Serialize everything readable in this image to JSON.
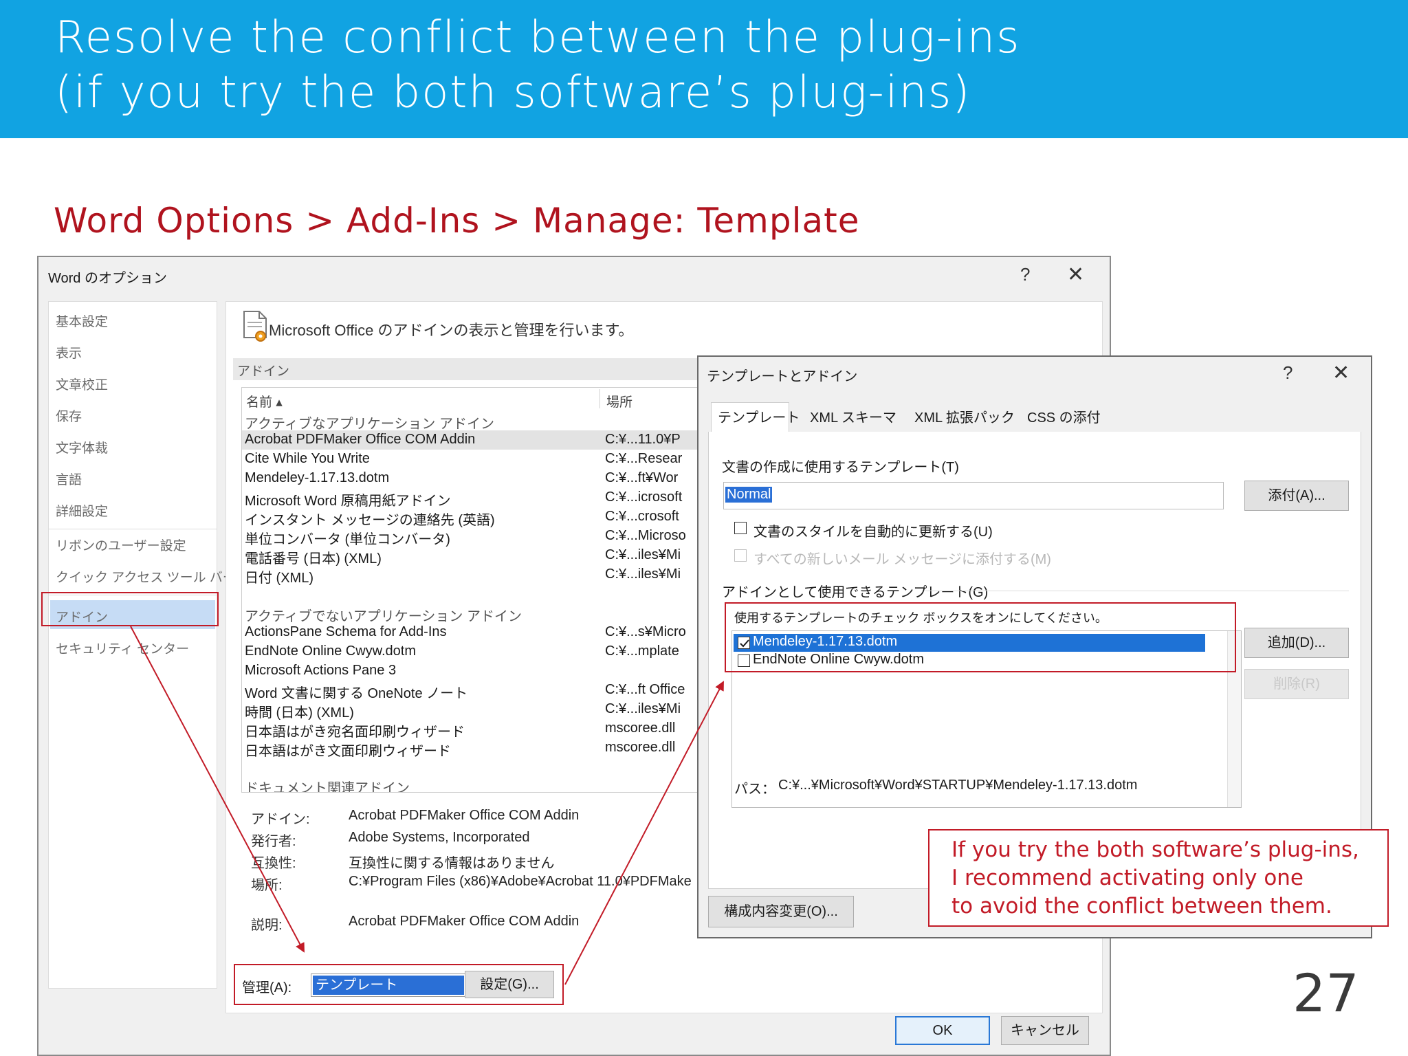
{
  "slide": {
    "title_line1": "Resolve the conflict between the plug-ins",
    "title_line2": "(if you try the both software’s plug-ins)",
    "subtitle": "Word Options > Add-Ins > Manage: Template",
    "page_number": "27",
    "callout": {
      "line1": "If you try the both software’s plug-ins,",
      "line2": "I recommend activating only one",
      "line3": "to avoid the conflict between them."
    },
    "colors": {
      "header": "#11a3e2",
      "accent_red": "#c21b27"
    }
  },
  "word_options": {
    "title": "Word のオプション",
    "help": "?",
    "close": "✕",
    "sidebar": [
      "基本設定",
      "表示",
      "文章校正",
      "保存",
      "文字体裁",
      "言語",
      "詳細設定",
      "リボンのユーザー設定",
      "クイック アクセス ツール バー",
      "アドイン",
      "セキュリティ センター"
    ],
    "heading": "Microsoft Office のアドインの表示と管理を行います。",
    "section_label": "アドイン",
    "columns": {
      "name": "名前 ▴",
      "location": "場所"
    },
    "rows": [
      {
        "name": "アクティブなアプリケーション アドイン",
        "location": ""
      },
      {
        "name": "Acrobat PDFMaker Office COM Addin",
        "location": "C:¥...11.0¥P"
      },
      {
        "name": "Cite While You Write",
        "location": "C:¥...Resear"
      },
      {
        "name": "Mendeley-1.17.13.dotm",
        "location": "C:¥...ft¥Wor"
      },
      {
        "name": "Microsoft Word 原稿用紙アドイン",
        "location": "C:¥...icrosoft"
      },
      {
        "name": "インスタント メッセージの連絡先 (英語)",
        "location": "C:¥...crosoft"
      },
      {
        "name": "単位コンバータ (単位コンバータ)",
        "location": "C:¥...Microso"
      },
      {
        "name": "電話番号 (日本) (XML)",
        "location": "C:¥...iles¥Mi"
      },
      {
        "name": "日付 (XML)",
        "location": "C:¥...iles¥Mi"
      },
      {
        "name": "",
        "location": ""
      },
      {
        "name": "アクティブでないアプリケーション アドイン",
        "location": ""
      },
      {
        "name": "ActionsPane Schema for Add-Ins",
        "location": "C:¥...s¥Micro"
      },
      {
        "name": "EndNote Online Cwyw.dotm",
        "location": "C:¥...mplate"
      },
      {
        "name": "Microsoft Actions Pane 3",
        "location": ""
      },
      {
        "name": "Word 文書に関する OneNote ノート",
        "location": "C:¥...ft Office"
      },
      {
        "name": "時間 (日本) (XML)",
        "location": "C:¥...iles¥Mi"
      },
      {
        "name": "日本語はがき宛名面印刷ウィザード",
        "location": "mscoree.dll"
      },
      {
        "name": "日本語はがき文面印刷ウィザード",
        "location": "mscoree.dll"
      },
      {
        "name": "",
        "location": ""
      },
      {
        "name": "ドキュメント関連アドイン",
        "location": ""
      }
    ],
    "details": [
      {
        "label": "アドイン:",
        "value": "Acrobat PDFMaker Office COM Addin"
      },
      {
        "label": "発行者:",
        "value": "Adobe Systems, Incorporated"
      },
      {
        "label": "互換性:",
        "value": "互換性に関する情報はありません"
      },
      {
        "label": "場所:",
        "value": "C:¥Program Files (x86)¥Adobe¥Acrobat 11.0¥PDFMake"
      },
      {
        "label": "説明:",
        "value": "Acrobat PDFMaker Office COM Addin"
      }
    ],
    "manage_label": "管理(A):",
    "manage_value": "テンプレート",
    "settings_button": "設定(G)...",
    "ok_button": "OK",
    "cancel_button": "キャンセル"
  },
  "templates_dialog": {
    "title": "テンプレートとアドイン",
    "help": "?",
    "close": "✕",
    "tabs": [
      "テンプレート",
      "XML スキーマ",
      "XML 拡張パック",
      "CSS の添付"
    ],
    "doc_template_label": "文書の作成に使用するテンプレート(T)",
    "doc_template_value": "Normal",
    "attach_button": "添付(A)...",
    "auto_update_label": "文書のスタイルを自動的に更新する(U)",
    "attach_mail_label": "すべての新しいメール メッセージに添付する(M)",
    "global_templates_label": "アドインとして使用できるテンプレート(G)",
    "global_hint": "使用するテンプレートのチェック ボックスをオンにしてください。",
    "global_items": [
      {
        "name": "Mendeley-1.17.13.dotm",
        "checked": true
      },
      {
        "name": "EndNote Online Cwyw.dotm",
        "checked": false
      }
    ],
    "add_button": "追加(D)...",
    "remove_button": "削除(R)",
    "path_label": "パス：",
    "path_value": "C:¥...¥Microsoft¥Word¥STARTUP¥Mendeley-1.17.13.dotm",
    "organizer_button": "構成内容変更(O)..."
  }
}
